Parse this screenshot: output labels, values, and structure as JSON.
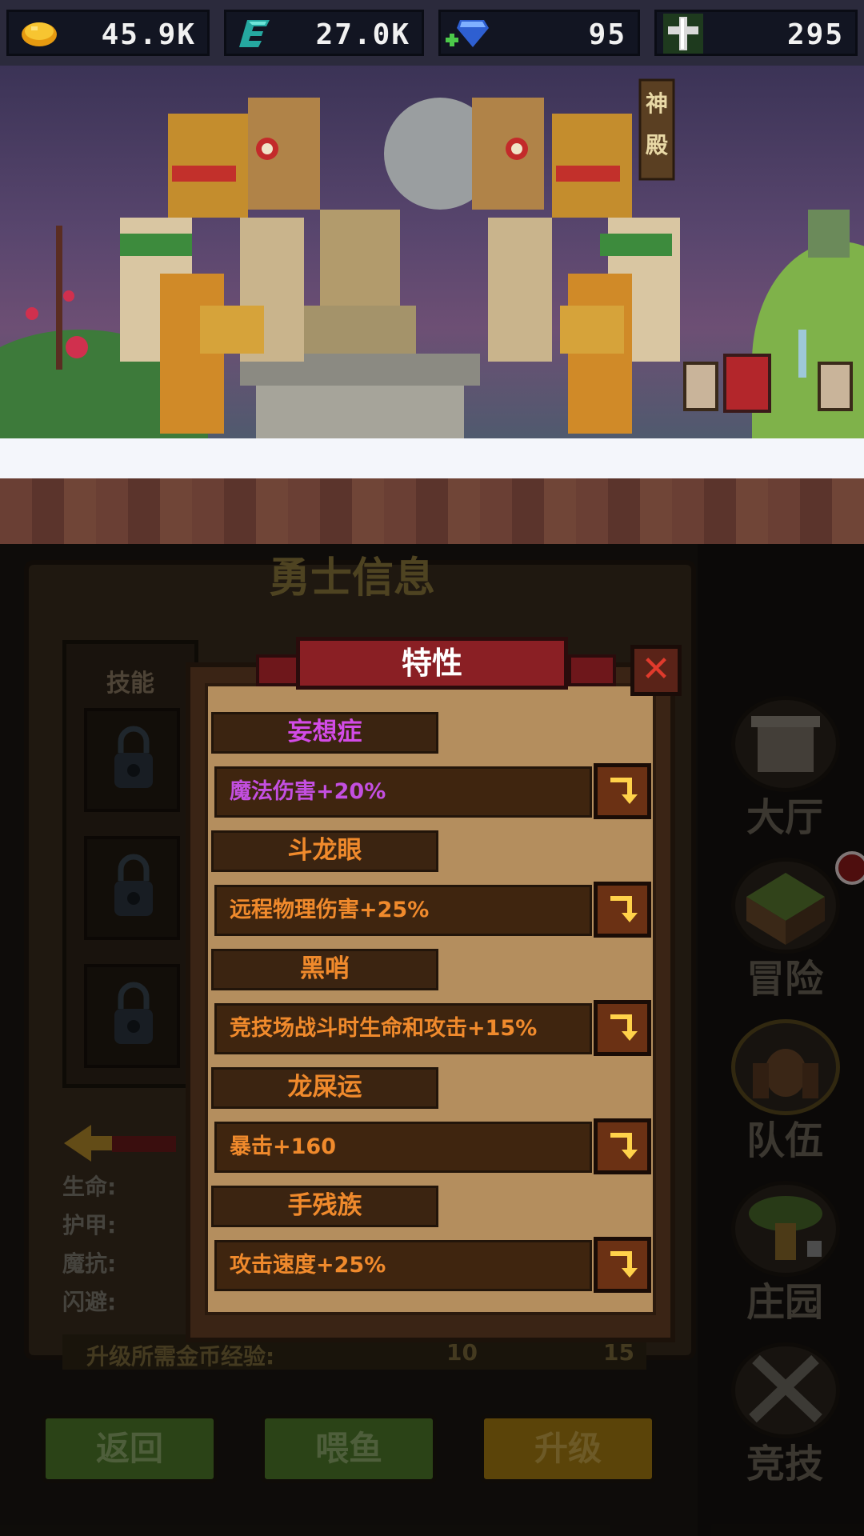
{
  "resources": {
    "gold": {
      "icon": "gold-nugget-icon",
      "value": "45.9K"
    },
    "energy": {
      "icon": "energy-e-icon",
      "value": "27.0K"
    },
    "gems": {
      "icon": "blue-gem-icon",
      "value": "95"
    },
    "cross": {
      "icon": "silver-cross-icon",
      "value": "295"
    }
  },
  "scene": {
    "temple_sign": "神\n殿"
  },
  "hero_info": {
    "title": "勇士信息",
    "skills_label": "技能",
    "stats": [
      "生命:",
      "护甲:",
      "魔抗:",
      "闪避:"
    ],
    "upgrade_requirement_label": "升级所需金币经验:",
    "upgrade_gold": "10",
    "upgrade_exp": "15"
  },
  "buttons": {
    "back": "返回",
    "feed_fish": "喂鱼",
    "upgrade": "升级"
  },
  "nav": [
    {
      "label": "大厅",
      "icon": "hall-icon"
    },
    {
      "label": "冒险",
      "icon": "adventure-icon"
    },
    {
      "label": "队伍",
      "icon": "team-icon"
    },
    {
      "label": "庄园",
      "icon": "manor-icon"
    },
    {
      "label": "竞技",
      "icon": "arena-icon"
    }
  ],
  "popup": {
    "title": "特性",
    "traits": [
      {
        "name": "妄想症",
        "name_color": "#d24be6",
        "effect": "魔法伤害+20%",
        "effect_color": "#c34fe0"
      },
      {
        "name": "斗龙眼",
        "name_color": "#f08a2c",
        "effect": "远程物理伤害+25%",
        "effect_color": "#f08a2c"
      },
      {
        "name": "黑哨",
        "name_color": "#f08a2c",
        "effect": "竞技场战斗时生命和攻击+15%",
        "effect_color": "#f08a2c"
      },
      {
        "name": "龙屎运",
        "name_color": "#f08a2c",
        "effect": "暴击+160",
        "effect_color": "#f08a2c"
      },
      {
        "name": "手残族",
        "name_color": "#f08a2c",
        "effect": "攻击速度+25%",
        "effect_color": "#f08a2c"
      }
    ]
  }
}
